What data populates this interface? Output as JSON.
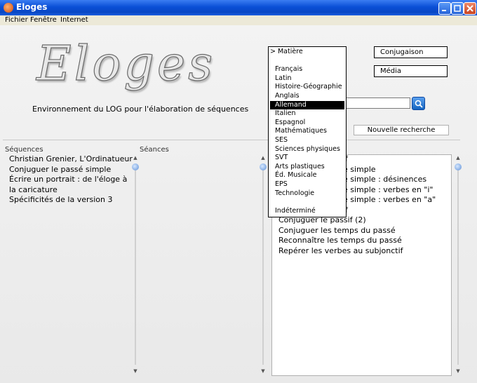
{
  "window": {
    "title": "Eloges"
  },
  "menu": [
    "Fichier",
    "Fenêtre",
    "Internet"
  ],
  "app": {
    "logo": "Eloges",
    "subtitle": "Environnement du LOG pour l'élaboration de séquences"
  },
  "buttons": {
    "conjugaison": "Conjugaison",
    "media": "Média",
    "new_search": "Nouvelle recherche"
  },
  "search": {
    "value": ""
  },
  "columns": {
    "sequences_label": "Séquences",
    "seances_label": "Séances"
  },
  "sequences": [
    "Christian Grenier, L'Ordinatueur",
    "Conjuguer le passé simple",
    "Écrire un portrait : de l'éloge à",
    "la caricature",
    "Spécificités de la version 3"
  ],
  "results_partial": [
    "if",
    "é simple",
    "é simple : désinences",
    "é simple : verbes en \"i\"",
    "é simple : verbes en \"a\"",
    "if"
  ],
  "results_full": [
    "Conjuguer le passif (2)",
    "Conjuguer les temps du passé",
    "Reconnaître les temps du passé",
    "Repérer les verbes au subjonctif"
  ],
  "dropdown": {
    "header": "> Matière",
    "items": [
      "Français",
      "Latin",
      "Histoire-Géographie",
      "Anglais",
      "Allemand",
      "Italien",
      "Espagnol",
      "Mathématiques",
      "SES",
      "Sciences physiques",
      "SVT",
      "Arts plastiques",
      "Éd. Musicale",
      "EPS",
      "Technologie"
    ],
    "last": "Indéterminé",
    "selected": "Allemand"
  },
  "colors": {
    "titlebar": "#0a4fd6",
    "selection": "#000000"
  },
  "icons": {
    "search": "magnifier-icon",
    "app": "app-icon"
  }
}
